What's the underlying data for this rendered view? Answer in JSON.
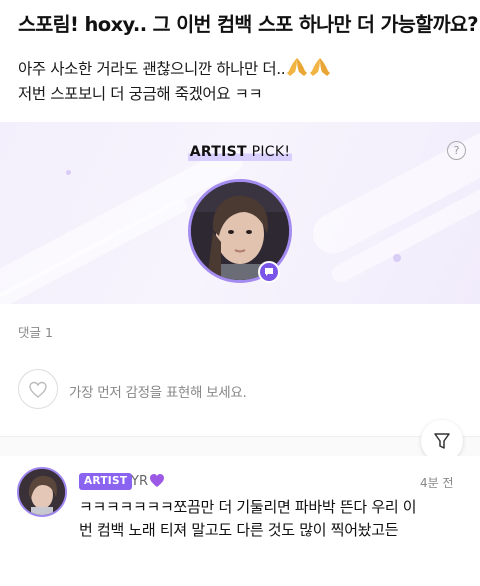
{
  "post": {
    "title": "스포림! hoxy.. 그 이번 컴백 스포 하나만 더 가능할까요?",
    "body_line1": "아주 사소한 거라도 괜찮으니깐 하나만 더..",
    "body_emoji": "🙏🙏",
    "body_line2": "저번 스포보니 더 궁금해 죽겠어요 ㅋㅋ"
  },
  "artist_pick": {
    "label_bold": "ARTIST",
    "label_rest": " PICK!",
    "help_symbol": "?",
    "badge_icon": "chat-bubble-icon",
    "accent_color": "#7b55e8"
  },
  "comments_section": {
    "count_label": "댓글 1",
    "emote_placeholder": "가장 먼저 감정을 표현해 보세요.",
    "filter_icon": "filter-icon"
  },
  "comment": {
    "badge": "ARTIST",
    "author": "YR",
    "author_emoji": "💜",
    "time": "4분 전",
    "text_line1": "ㅋㅋㅋㅋㅋㅋㅋ쪼끔만 더 기둘리면 파바박 뜬다 우리 이",
    "text_line2": "번 컴백 노래 티져 말고도 다른 것도 많이 찍어놨고든",
    "badge_color": "#8a63f0"
  }
}
